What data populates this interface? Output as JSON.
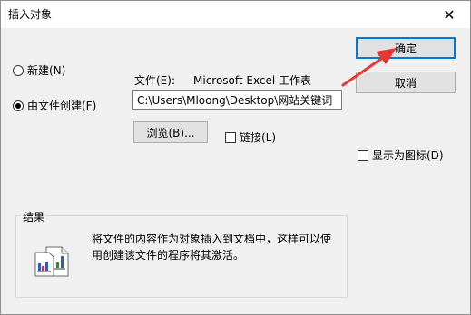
{
  "dialog": {
    "title": "插入对象",
    "close_glyph": "✕"
  },
  "options": {
    "new_label": "新建(N)",
    "from_file_label": "由文件创建(F)",
    "selected": "from_file"
  },
  "file": {
    "label": "文件(E):",
    "type_text": "Microsoft Excel 工作表",
    "path_value": "C:\\Users\\Mloong\\Desktop\\网站关键词"
  },
  "buttons": {
    "ok": "确定",
    "cancel": "取消",
    "browse": "浏览(B)..."
  },
  "checkboxes": {
    "link_label": "链接(L)",
    "link_checked": false,
    "display_icon_label": "显示为图标(D)",
    "display_icon_checked": false
  },
  "result": {
    "group_label": "结果",
    "text": "将文件的内容作为对象插入到文档中，这样可以使用创建该文件的程序将其激活。"
  },
  "colors": {
    "arrow": "#e53935",
    "default_button_border": "#0078d7"
  }
}
